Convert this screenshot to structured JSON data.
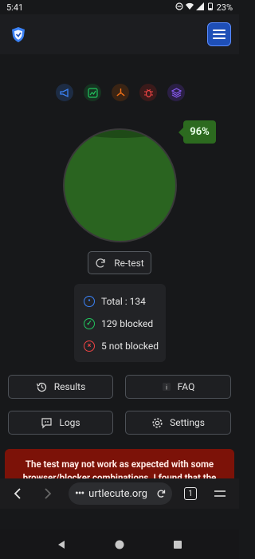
{
  "status_bar": {
    "time": "5:41",
    "battery": "23%"
  },
  "header": {
    "logo_icon": "shield-logo-icon",
    "menu_icon": "hamburger-menu-icon"
  },
  "categories": [
    {
      "icon": "megaphone-icon",
      "color": "#3b82f6"
    },
    {
      "icon": "chart-icon",
      "color": "#22c55e"
    },
    {
      "icon": "fan-icon",
      "color": "#f97316"
    },
    {
      "icon": "bug-icon",
      "color": "#ef4444"
    },
    {
      "icon": "layers-icon",
      "color": "#8b5cf6"
    }
  ],
  "score": {
    "percent": "96%",
    "fill_fraction": 0.96,
    "color": "#2a6420"
  },
  "retest_label": "Re-test",
  "summary": {
    "total": "Total : 134",
    "blocked": "129 blocked",
    "not_blocked": "5 not blocked"
  },
  "buttons": {
    "results": "Results",
    "faq": "FAQ",
    "logs": "Logs",
    "settings": "Settings"
  },
  "warning": "The test may not work as expected with some browser/blocker combinations. I found that the uBlock Origin extension breaks the final result.",
  "browser": {
    "url": "urtlecute.org",
    "tab_count": "1"
  }
}
